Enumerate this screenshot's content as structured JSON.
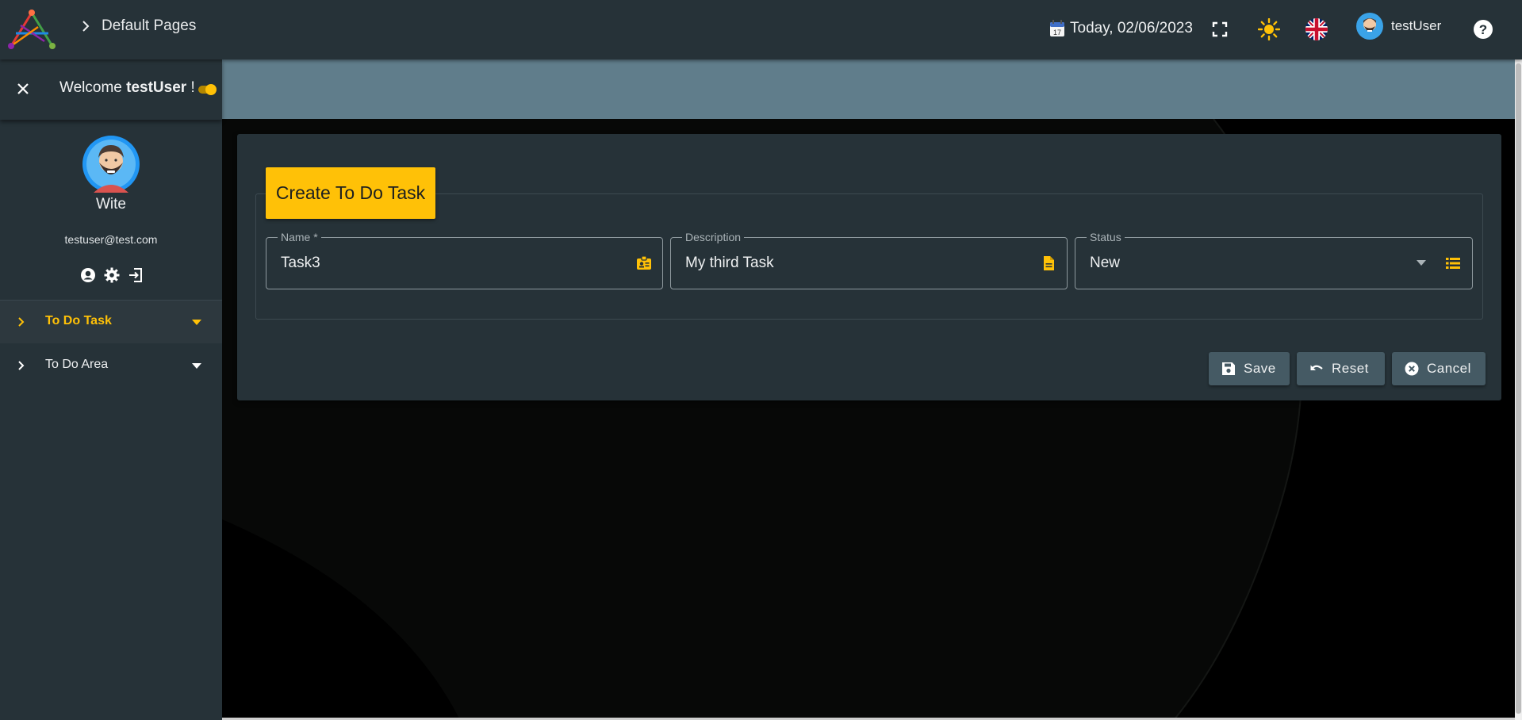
{
  "header": {
    "breadcrumb": "Default Pages",
    "date": "Today, 02/06/2023",
    "calendar_day": "17",
    "username": "testUser",
    "icons": [
      "app-logo-icon",
      "chevron-right-icon",
      "calendar-icon",
      "fullscreen-icon",
      "sun-icon",
      "uk-flag-icon",
      "avatar-icon",
      "help-icon"
    ]
  },
  "sidebar": {
    "welcome_prefix": "Welcome",
    "welcome_user": "testUser",
    "welcome_suffix": "!",
    "profile_name": "Wite",
    "email": "testuser@test.com",
    "items": [
      {
        "label": "To Do Task",
        "active": true
      },
      {
        "label": "To Do Area",
        "active": false
      }
    ]
  },
  "form": {
    "title": "Create To Do Task",
    "name": {
      "label": "Name *",
      "value": "Task3"
    },
    "description": {
      "label": "Description",
      "value": "My third Task"
    },
    "status": {
      "label": "Status",
      "value": "New"
    }
  },
  "actions": {
    "save": "Save",
    "reset": "Reset",
    "cancel": "Cancel"
  },
  "colors": {
    "accent": "#ffc107",
    "panel": "#263238",
    "banner": "#607d8b",
    "button": "#455a64"
  }
}
